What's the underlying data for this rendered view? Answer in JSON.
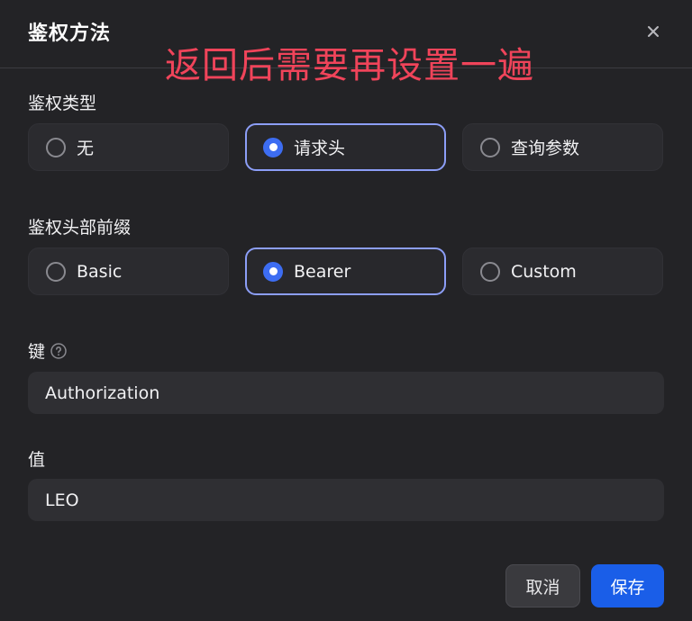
{
  "dialog": {
    "title": "鉴权方法",
    "annotation": "返回后需要再设置一遍"
  },
  "auth_type": {
    "label": "鉴权类型",
    "options": [
      "无",
      "请求头",
      "查询参数"
    ],
    "selected": "请求头"
  },
  "prefix": {
    "label": "鉴权头部前缀",
    "options": [
      "Basic",
      "Bearer",
      "Custom"
    ],
    "selected": "Bearer"
  },
  "key_field": {
    "label": "键",
    "value": "Authorization"
  },
  "value_field": {
    "label": "值",
    "value": "LEO"
  },
  "buttons": {
    "cancel": "取消",
    "save": "保存"
  },
  "colors": {
    "accent": "#1a5ee8",
    "selected_border": "#8c9ef7",
    "annotation": "#f0445a",
    "background": "#232326"
  }
}
